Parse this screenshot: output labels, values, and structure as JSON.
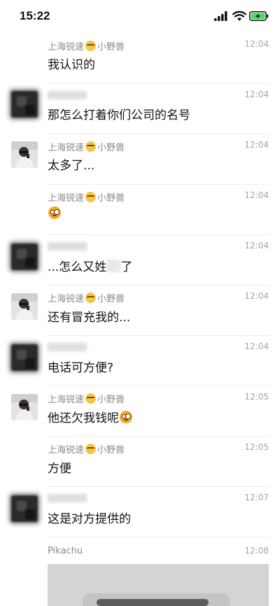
{
  "status_bar": {
    "time": "15:22",
    "icons": [
      "signal-icon",
      "wifi-icon",
      "battery-charging-icon"
    ]
  },
  "messages": [
    {
      "sender": "上海锐速",
      "sender_suffix": "小野兽",
      "time": "12:04",
      "text": "我认识的"
    },
    {
      "time": "12:04",
      "text": "那怎么打着你们公司的名号"
    },
    {
      "sender": "上海锐速",
      "sender_suffix": "小野兽",
      "time": "12:04",
      "text": "太多了..."
    },
    {
      "sender": "上海锐速",
      "sender_suffix": "小野兽",
      "time": "12:04",
      "emoji": "flushed-face-emoji"
    },
    {
      "time": "12:04",
      "text": "...怎么又姓",
      "text_after_mask": "了"
    },
    {
      "sender": "上海锐速",
      "sender_suffix": "小野兽",
      "time": "12:04",
      "text": "还有冒充我的..."
    },
    {
      "time": "12:04",
      "text": "电话可方便?"
    },
    {
      "sender": "上海锐速",
      "sender_suffix": "小野兽",
      "time": "12:05",
      "text": "他还欠我钱呢",
      "emoji": "flushed-face-emoji"
    },
    {
      "sender": "上海锐速",
      "sender_suffix": "小野兽",
      "time": "12:05",
      "text": "方便"
    },
    {
      "time": "12:07",
      "text": "这是对方提供的"
    },
    {
      "sender": "Pikachu",
      "time": "12:08"
    }
  ],
  "colors": {
    "sender": "#8a8a8a",
    "time": "#a5a5a5",
    "text": "#111111",
    "battery": "#4cd964"
  }
}
